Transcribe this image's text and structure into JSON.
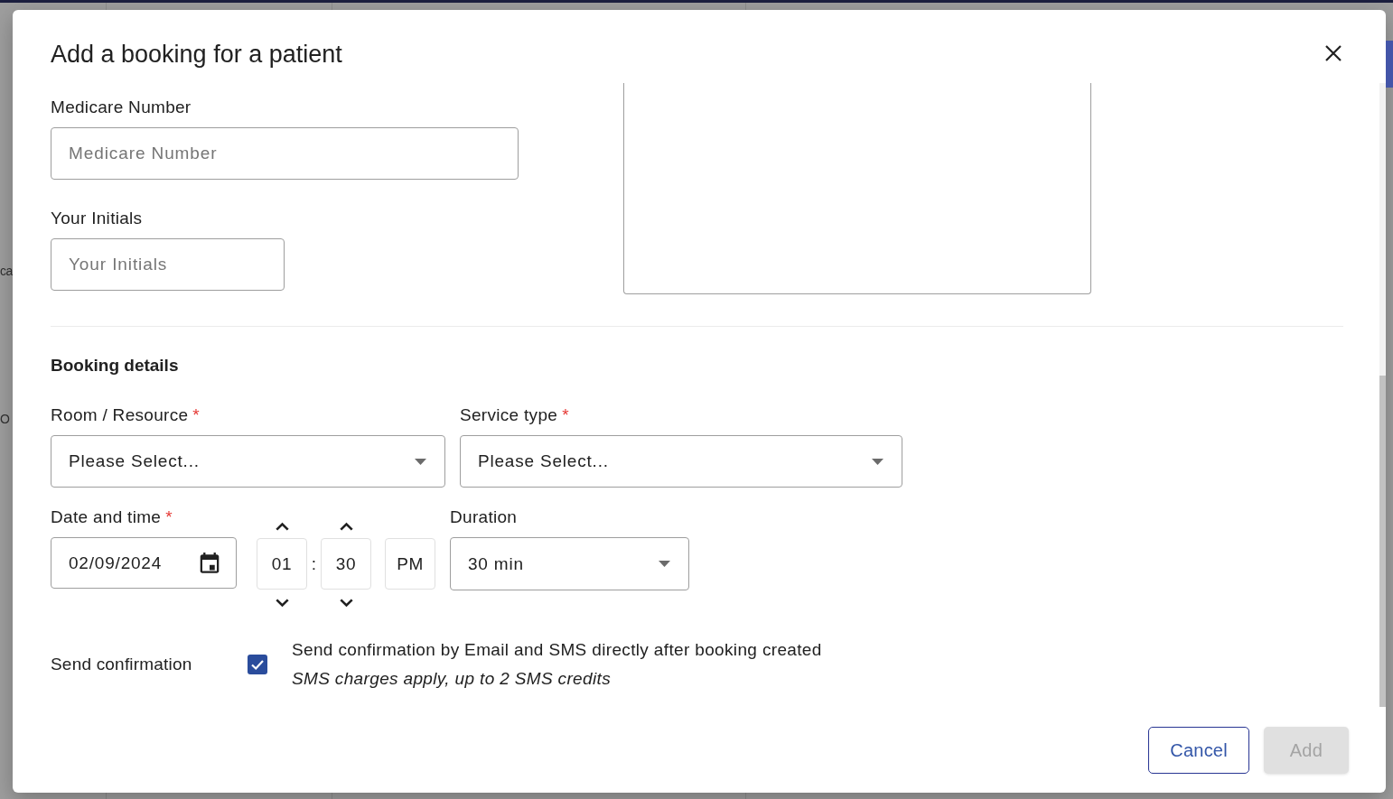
{
  "background": {
    "fragments": [
      "ca",
      "O"
    ]
  },
  "dialog": {
    "title": "Add a booking for a patient",
    "medicare_number": {
      "label": "Medicare Number",
      "placeholder": "Medicare Number"
    },
    "initials": {
      "label": "Your Initials",
      "placeholder": "Your Initials"
    },
    "booking_details": {
      "heading": "Booking details",
      "room": {
        "label": "Room / Resource",
        "required_mark": "*",
        "value": "Please Select..."
      },
      "service_type": {
        "label": "Service type",
        "required_mark": "*",
        "value": "Please Select..."
      },
      "date_time": {
        "label": "Date and time",
        "required_mark": "*",
        "date": "02/09/2024",
        "hour": "01",
        "separator": ":",
        "minute": "30",
        "period": "PM"
      },
      "duration": {
        "label": "Duration",
        "value": "30 min"
      },
      "confirmation": {
        "label": "Send confirmation",
        "checked": true,
        "text": "Send confirmation by Email and SMS directly after booking created",
        "note": "SMS charges apply, up to 2 SMS credits"
      }
    },
    "buttons": [
      {
        "label": "Cancel",
        "kind": "outlined",
        "disabled": false
      },
      {
        "label": "Add",
        "kind": "contained",
        "disabled": true
      }
    ]
  }
}
